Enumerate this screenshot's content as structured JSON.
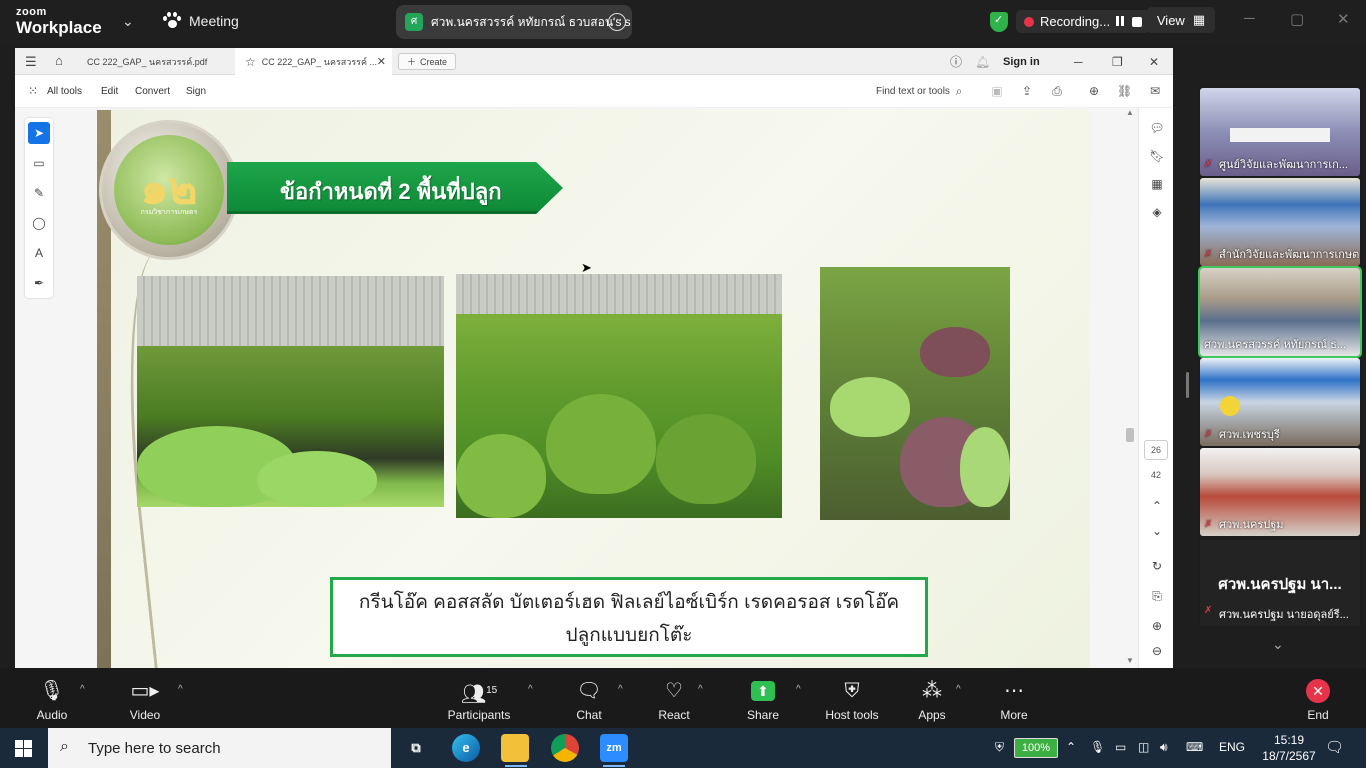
{
  "zoom_top": {
    "logo_line1": "zoom",
    "logo_line2": "Workplace",
    "meeting_label": "Meeting",
    "share_avatar": "ศ",
    "share_banner": "ศวพ.นครสวรรค์ หทัยกรณ์ ธวบสอน's s",
    "recording_label": "Recording...",
    "view_label": "View"
  },
  "acrobat": {
    "tab1": "CC 222_GAP_ นครสวรรค์.pdf",
    "tab2": "CC 222_GAP_ นครสวรรค์ ...",
    "create_label": "Create",
    "sign_in": "Sign in",
    "menu": [
      "All tools",
      "Edit",
      "Convert",
      "Sign"
    ],
    "find_placeholder": "Find text or tools",
    "page_current": "26",
    "page_total": "42"
  },
  "slide": {
    "emblem_number": "๑๒",
    "emblem_sub": "กรมวิชาการเกษตร",
    "title": "ข้อกำหนดที่ 2 พื้นที่ปลูก",
    "caption_line1": "กรีนโอ๊ค คอสสลัด บัตเตอร์เฮด  ฟิลเลย์ไอซ์เบิร์ก เรดคอรอส  เรดโอ๊ค",
    "caption_line2": "ปลูกแบบยกโต๊ะ"
  },
  "gallery": {
    "participants": [
      {
        "name": "ศูนย์วิจัยและพัฒนาการเก..."
      },
      {
        "name": "สำนักวิจัยและพัฒนาการเกษต..."
      },
      {
        "name": "ศวพ.นครสวรรค์ หทัยกรณ์ ธ..."
      },
      {
        "name": "ศวพ.เพชรบุรี"
      },
      {
        "name": "ศวพ.นครปฐม"
      }
    ],
    "name_tile_big": "ศวพ.นครปฐม นา...",
    "name_tile_label": "ศวพ.นครปฐม นายอดุลย์รี..."
  },
  "zoom_bottom": {
    "audio": "Audio",
    "video": "Video",
    "participants": "Participants",
    "participants_count": "15",
    "chat": "Chat",
    "react": "React",
    "share": "Share",
    "host_tools": "Host tools",
    "apps": "Apps",
    "more": "More",
    "end": "End"
  },
  "taskbar": {
    "search_placeholder": "Type here to search",
    "zoom_app": "zm",
    "battery": "100%",
    "language": "ENG",
    "time": "15:19",
    "date": "18/7/2567"
  },
  "colors": {
    "slide_green": "#1ea64a",
    "zoom_active_outline": "#3ec95e",
    "end_red": "#e8344a",
    "acrobat_select_blue": "#1473e6"
  }
}
